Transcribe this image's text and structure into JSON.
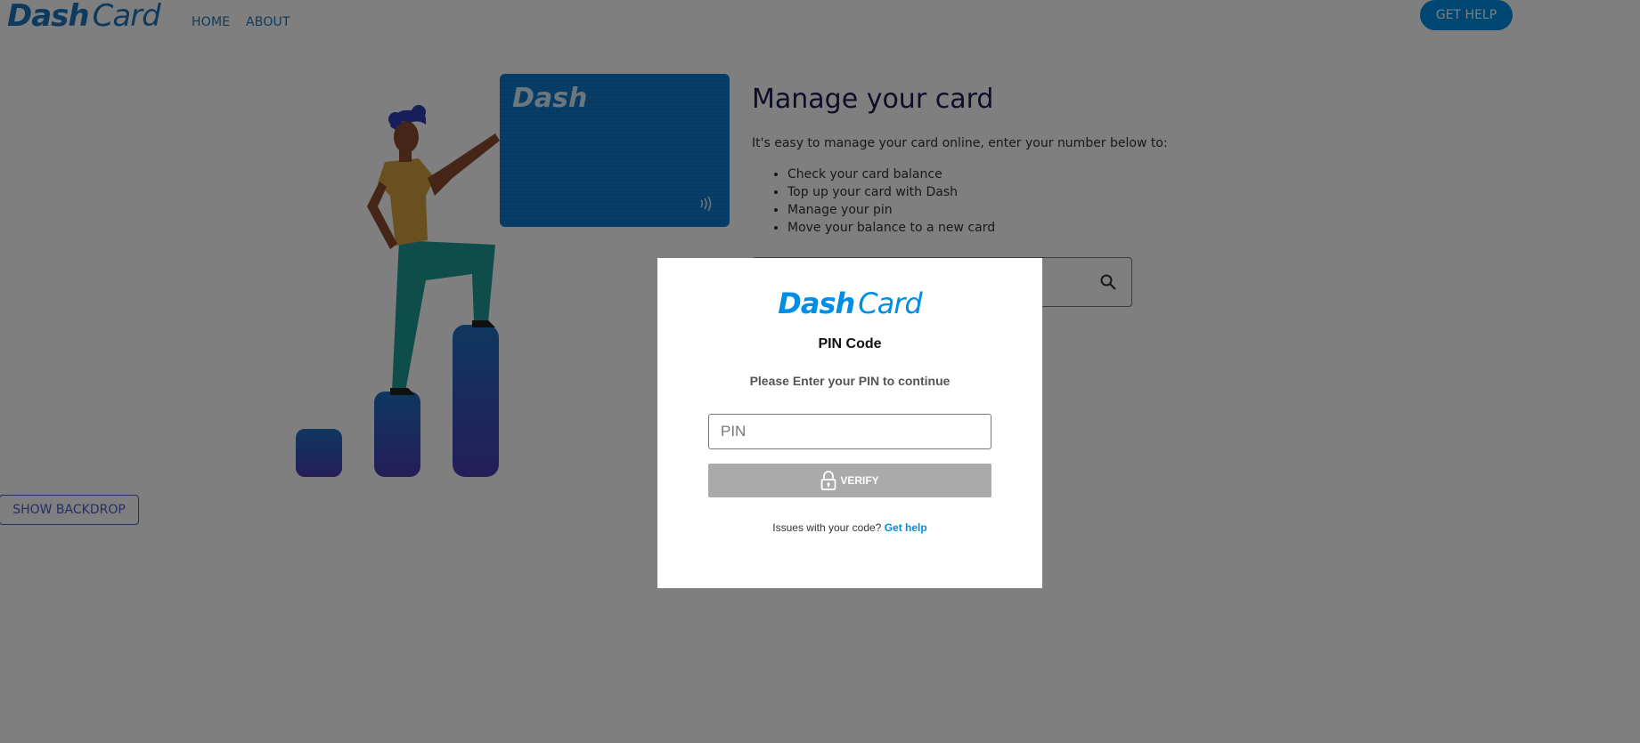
{
  "header": {
    "logo": {
      "dash": "Dash",
      "card": "Card"
    },
    "nav": [
      {
        "label": "HOME"
      },
      {
        "label": "ABOUT"
      }
    ],
    "help_button": "GET HELP"
  },
  "hero": {
    "card_brand": "Dash",
    "title": "Manage your card",
    "intro": "It's easy to manage your card online, enter your number below to:",
    "features": [
      "Check your card balance",
      "Top up your card with Dash",
      "Manage your pin",
      "Move your balance to a new card"
    ]
  },
  "show_backdrop_button": "SHOW BACKDROP",
  "modal": {
    "logo": {
      "dash": "Dash",
      "card": "Card"
    },
    "title": "PIN Code",
    "subtitle": "Please Enter your PIN to continue",
    "pin_placeholder": "PIN",
    "verify_label": "VERIFY",
    "help_text": "Issues with your code?",
    "help_link": "Get help"
  },
  "colors": {
    "brand_blue": "#1c75bc",
    "accent_blue": "#008de4",
    "verify_disabled": "#aaaaaa"
  },
  "icons": [
    "search-icon",
    "lock-icon",
    "contactless-icon"
  ]
}
